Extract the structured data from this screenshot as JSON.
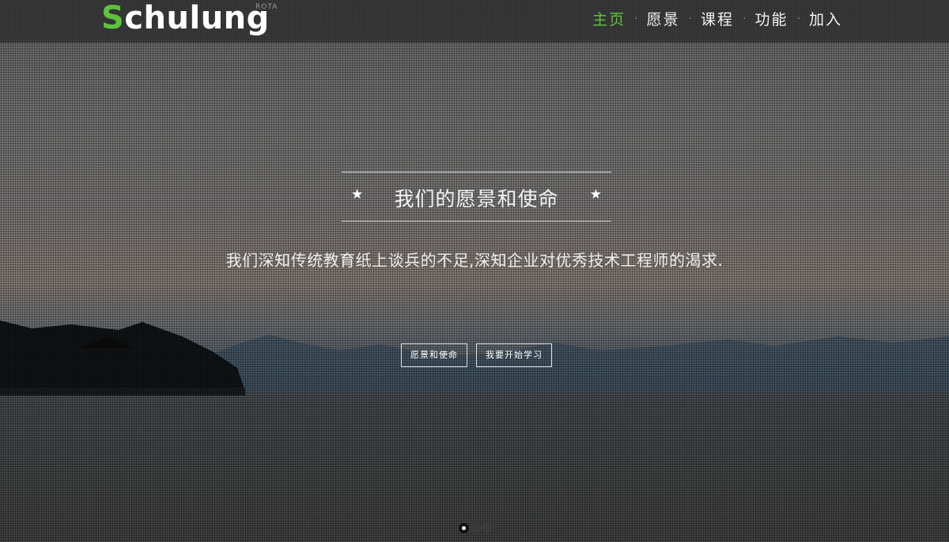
{
  "brand": {
    "first_letter": "S",
    "rest": "chulung",
    "sub": "ROTA"
  },
  "nav": {
    "items": [
      {
        "label": "主页",
        "active": true
      },
      {
        "label": "愿景",
        "active": false
      },
      {
        "label": "课程",
        "active": false
      },
      {
        "label": "功能",
        "active": false
      },
      {
        "label": "加入",
        "active": false
      }
    ],
    "separator": "·"
  },
  "hero": {
    "star": "★",
    "title": "我们的愿景和使命",
    "subtitle": "我们深知传统教育纸上谈兵的不足,深知企业对优秀技术工程师的渴求.",
    "buttons": [
      "愿景和使命",
      "我要开始学习"
    ]
  },
  "carousel": {
    "slides": 3,
    "active_index": 0
  },
  "colors": {
    "accent": "#5cc43c",
    "navbar": "#2c2c2c"
  }
}
